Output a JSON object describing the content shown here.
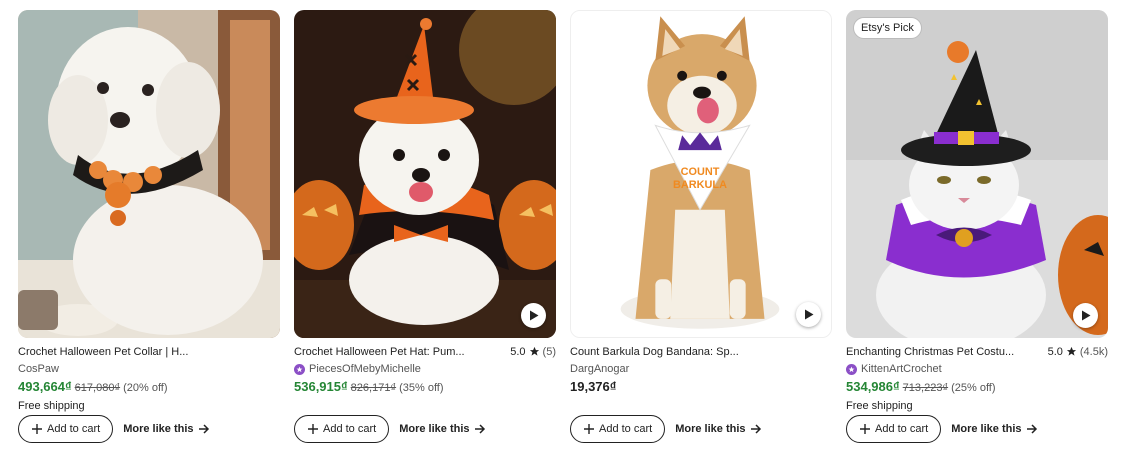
{
  "products": [
    {
      "title": "Crochet Halloween Pet Collar | H...",
      "seller": "CosPaw",
      "star_seller": false,
      "price": "493,664₫",
      "original_price": "617,080₫",
      "discount": "(20% off)",
      "shipping": "Free shipping",
      "rating": "",
      "rating_count": "",
      "badge": "",
      "has_video": false,
      "image": "white-poodle-with-orange-black-crochet-collar"
    },
    {
      "title": "Crochet Halloween Pet Hat: Pum...",
      "seller": "PiecesOfMebyMichelle",
      "star_seller": true,
      "price": "536,915₫",
      "original_price": "826,171₫",
      "discount": "(35% off)",
      "shipping": "",
      "rating": "5.0",
      "rating_count": "(5)",
      "badge": "",
      "has_video": true,
      "image": "white-dog-in-orange-witch-hat-and-cape"
    },
    {
      "title": "Count Barkula Dog Bandana: Sp...",
      "seller": "DargAnogar",
      "star_seller": false,
      "price": "19,376₫",
      "original_price": "",
      "discount": "",
      "shipping": "",
      "rating": "",
      "rating_count": "",
      "badge": "",
      "has_video": true,
      "image": "shiba-inu-with-count-barkula-bandana",
      "bandana_text": [
        "COUNT",
        "BARKULA"
      ]
    },
    {
      "title": "Enchanting Christmas Pet Costu...",
      "seller": "KittenArtCrochet",
      "star_seller": true,
      "price": "534,986₫",
      "original_price": "713,223₫",
      "discount": "(25% off)",
      "shipping": "Free shipping",
      "rating": "5.0",
      "rating_count": "(4.5k)",
      "badge": "Etsy's Pick",
      "has_video": true,
      "image": "white-cat-in-purple-witch-hat-and-collar"
    }
  ],
  "labels": {
    "add_to_cart": "Add to cart",
    "more_like_this": "More like this"
  },
  "colors": {
    "sale_price": "#258635",
    "star_seller": "#8b4fc6"
  },
  "icons": {
    "add": "plus-icon",
    "more": "arrow-right-icon",
    "rating": "star-icon",
    "video": "play-icon"
  }
}
